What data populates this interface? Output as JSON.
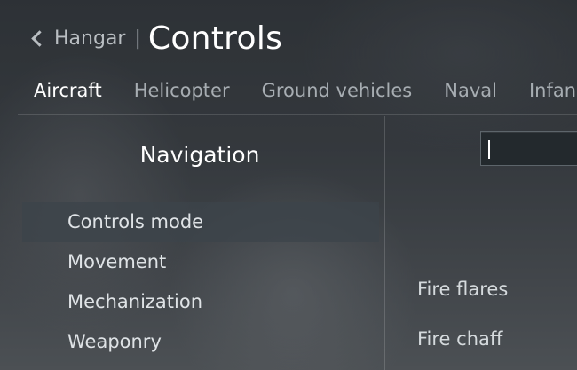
{
  "header": {
    "back_label": "Hangar",
    "separator": "|",
    "title": "Controls"
  },
  "tabs": [
    {
      "label": "Aircraft",
      "active": true
    },
    {
      "label": "Helicopter",
      "active": false
    },
    {
      "label": "Ground vehicles",
      "active": false
    },
    {
      "label": "Naval",
      "active": false
    },
    {
      "label": "Infan",
      "active": false
    }
  ],
  "navigation": {
    "title": "Navigation",
    "items": [
      {
        "label": "Controls mode",
        "selected": true
      },
      {
        "label": "Movement",
        "selected": false
      },
      {
        "label": "Mechanization",
        "selected": false
      },
      {
        "label": "Weaponry",
        "selected": false
      }
    ]
  },
  "search": {
    "value": "",
    "placeholder": ""
  },
  "actions": [
    {
      "label": "Fire flares"
    },
    {
      "label": "Fire chaff"
    }
  ],
  "colors": {
    "accent": "#d2533f",
    "selected_row": "#3c444a"
  }
}
